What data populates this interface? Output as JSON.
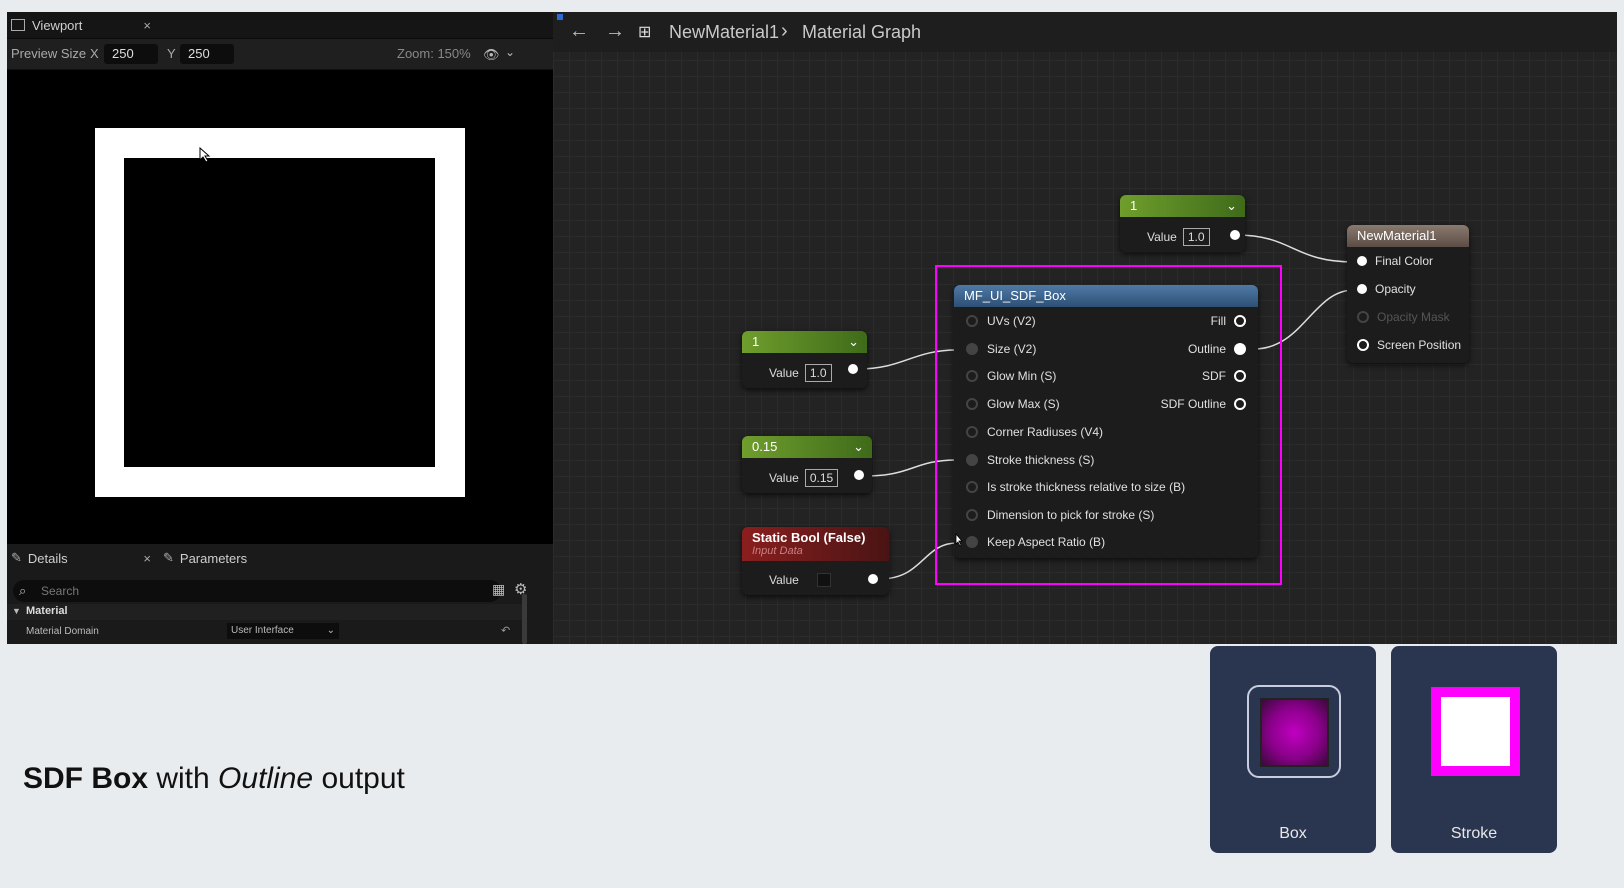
{
  "viewport": {
    "tab_title": "Viewport",
    "close": "×",
    "preview_size_label": "Preview Size",
    "x_label": "X",
    "x_value": "250",
    "y_label": "Y",
    "y_value": "250",
    "zoom": "Zoom: 150%"
  },
  "details": {
    "tab_details": "Details",
    "tab_parameters": "Parameters",
    "close": "×",
    "search_placeholder": "Search",
    "section": "Material",
    "row_label": "Material Domain",
    "row_value": "User Interface"
  },
  "graph": {
    "breadcrumb_material": "NewMaterial1",
    "breadcrumb_sep": "›",
    "breadcrumb_graph": "Material Graph",
    "const_top": {
      "title": "1",
      "value_label": "Value",
      "value": "1.0"
    },
    "const_size": {
      "title": "1",
      "value_label": "Value",
      "value": "1.0"
    },
    "const_stroke": {
      "title": "0.15",
      "value_label": "Value",
      "value": "0.15"
    },
    "static_bool": {
      "title": "Static Bool (False)",
      "subtitle": "Input Data",
      "value_label": "Value"
    },
    "sdf_node": {
      "title": "MF_UI_SDF_Box",
      "inputs": [
        "UVs (V2)",
        "Size (V2)",
        "Glow Min (S)",
        "Glow Max (S)",
        "Corner Radiuses (V4)",
        "Stroke thickness (S)",
        "Is stroke thickness relative to size (B)",
        "Dimension to pick for stroke (S)",
        "Keep Aspect Ratio (B)"
      ],
      "outputs": [
        "Fill",
        "Outline",
        "SDF",
        "SDF Outline"
      ]
    },
    "material_node": {
      "title": "NewMaterial1",
      "pins": [
        "Final Color",
        "Opacity",
        "Opacity Mask",
        "Screen Position"
      ]
    }
  },
  "caption": {
    "bold": "SDF Box",
    "mid": " with ",
    "italic": "Outline",
    "end": " output"
  },
  "cards": [
    {
      "label": "Box"
    },
    {
      "label": "Stroke"
    }
  ],
  "colors": {
    "highlight": "#ff00ff",
    "card_bg": "#2a3550",
    "box_fill": "#a000a0",
    "stroke_magenta": "#ff00ff"
  }
}
